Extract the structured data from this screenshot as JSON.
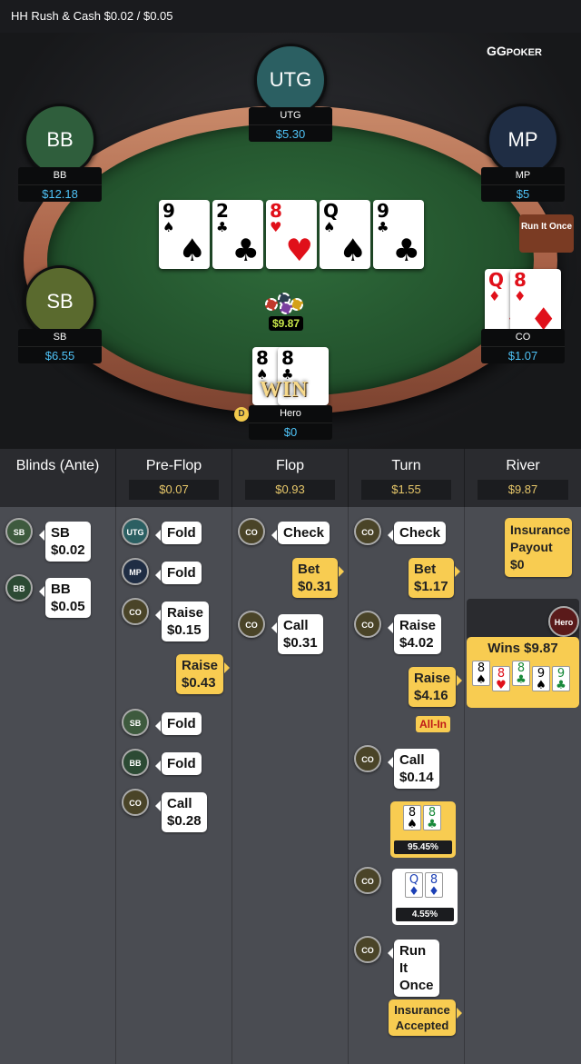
{
  "header": {
    "title": "HH  Rush & Cash $0.02 / $0.05"
  },
  "logo": {
    "text1": "GG",
    "text2": "POKER"
  },
  "seats": {
    "utg": {
      "badge": "UTG",
      "name": "UTG",
      "stack": "$5.30",
      "color": "#2b5f62"
    },
    "bb": {
      "badge": "BB",
      "name": "BB",
      "stack": "$12.18",
      "color": "#2f5e3c"
    },
    "mp": {
      "badge": "MP",
      "name": "MP",
      "stack": "$5",
      "color": "#1f2d44"
    },
    "sb": {
      "badge": "SB",
      "name": "SB",
      "stack": "$6.55",
      "color": "#5a6a2e"
    },
    "co": {
      "name": "CO",
      "stack": "$1.07"
    },
    "hero": {
      "name": "Hero",
      "stack": "$0"
    }
  },
  "board": [
    {
      "rank": "9",
      "suit": "♠",
      "red": false
    },
    {
      "rank": "2",
      "suit": "♣",
      "red": false
    },
    {
      "rank": "8",
      "suit": "♥",
      "red": true
    },
    {
      "rank": "Q",
      "suit": "♠",
      "red": false
    },
    {
      "rank": "9",
      "suit": "♣",
      "red": false
    }
  ],
  "co_cards": [
    {
      "rank": "Q",
      "suit": "♦"
    },
    {
      "rank": "8",
      "suit": "♦"
    }
  ],
  "hero_cards": [
    {
      "rank": "8",
      "suit": "♠"
    },
    {
      "rank": "8",
      "suit": "♣"
    }
  ],
  "run_it_once": "Run It Once",
  "pot": "$9.87",
  "dealer": "D",
  "win_text": "WIN",
  "streets": [
    {
      "name": "Blinds (Ante)",
      "total": ""
    },
    {
      "name": "Pre-Flop",
      "total": "$0.07"
    },
    {
      "name": "Flop",
      "total": "$0.93"
    },
    {
      "name": "Turn",
      "total": "$1.55"
    },
    {
      "name": "River",
      "total": "$9.87"
    }
  ],
  "blinds": [
    {
      "pos": "SB",
      "action": "SB",
      "amount": "$0.02"
    },
    {
      "pos": "BB",
      "action": "BB",
      "amount": "$0.05"
    }
  ],
  "preflop": [
    {
      "pos": "UTG",
      "action": "Fold"
    },
    {
      "pos": "MP",
      "action": "Fold"
    },
    {
      "pos": "CO",
      "action": "Raise",
      "amount": "$0.15"
    },
    {
      "pos": "Hero",
      "action": "Raise",
      "amount": "$0.43"
    },
    {
      "pos": "SB",
      "action": "Fold"
    },
    {
      "pos": "BB",
      "action": "Fold"
    },
    {
      "pos": "CO",
      "action": "Call",
      "amount": "$0.28"
    }
  ],
  "flop": [
    {
      "pos": "CO",
      "action": "Check"
    },
    {
      "pos": "Hero",
      "action": "Bet",
      "amount": "$0.31"
    },
    {
      "pos": "CO",
      "action": "Call",
      "amount": "$0.31"
    }
  ],
  "turn": [
    {
      "pos": "CO",
      "action": "Check"
    },
    {
      "pos": "Hero",
      "action": "Bet",
      "amount": "$1.17"
    },
    {
      "pos": "CO",
      "action": "Raise",
      "amount": "$4.02"
    },
    {
      "pos": "Hero",
      "action": "Raise",
      "amount": "$4.16",
      "tag": "All-In"
    },
    {
      "pos": "CO",
      "action": "Call",
      "amount": "$0.14"
    },
    {
      "pos": "Hero",
      "equity": "95.45%"
    },
    {
      "pos": "CO",
      "equity": "4.55%"
    },
    {
      "pos": "CO",
      "action": "Run It Once"
    },
    {
      "pos": "Hero",
      "action": "Insurance Accepted"
    }
  ],
  "river": {
    "insurance_label": "Insurance Payout",
    "insurance_amount": "$0",
    "winner_badge": "Hero",
    "wins_text": "Wins $9.87"
  },
  "colors": {
    "accent": "#f8cc51",
    "stack": "#4fc3f7",
    "total": "#e8c86a"
  }
}
